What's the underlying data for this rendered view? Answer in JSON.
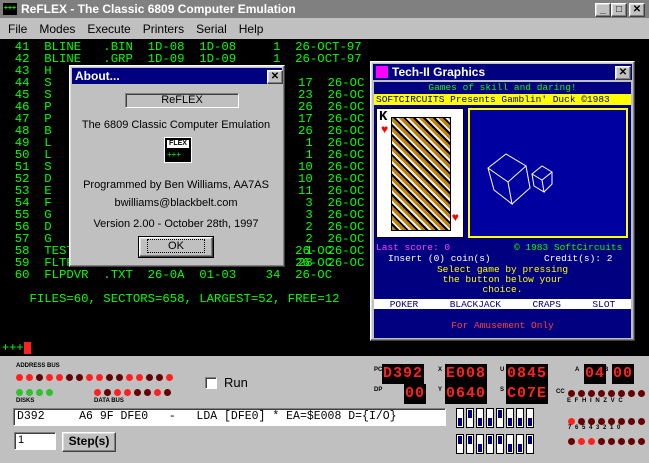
{
  "main_window": {
    "title": "ReFLEX - The Classic 6809 Computer Emulation"
  },
  "menu": [
    "File",
    "Modes",
    "Execute",
    "Printers",
    "Serial",
    "Help"
  ],
  "terminal": {
    "lines": [
      "  41  BLINE   .BIN  1D-08  1D-08     1  26-OCT-97",
      "  42  BLINE   .GRP  1D-09  1D-09     1  26-OCT-97",
      "  43  H",
      "  44  S",
      "  45  S",
      "  46  P",
      "  47  P",
      "  48  B",
      "  49  L",
      "  50  L",
      "  51  S",
      "  52  D",
      "  53  E",
      "  54  F",
      "  55  G",
      "  56  D",
      "  57  G",
      "  58  TEST    .CAL  25-03  25-03     1  26-OC",
      "  59  FLTPT   .TXT  25-04  26-09    26  26-OC",
      "  60  FLPDVR  .TXT  26-0A  01-03    34  26-OC",
      "",
      "    FILES=60, SECTORS=658, LARGEST=52, FREE=12"
    ],
    "right_cols": [
      "17  26-OC",
      "23  26-OC",
      "26  26-OC",
      "17  26-OC",
      "26  26-OC",
      "1  26-OC",
      "1  26-OC",
      "10  26-OC",
      "10  26-OC",
      "11  26-OC",
      "3  26-OC",
      "3  26-OC",
      "2  26-OC",
      "2  26-OC",
      "1  26-OC",
      "28  26-OC"
    ],
    "prompt": "+++"
  },
  "about": {
    "title": "About...",
    "name": "ReFLEX",
    "subtitle": "The 6809 Classic Computer Emulation",
    "icon_text": "FLEX",
    "icon_prompt": "+++",
    "author": "Programmed by Ben Williams, AA7AS",
    "email": "bwilliams@blackbelt.com",
    "version": "Version 2.00 - October 28th, 1997",
    "ok": "OK"
  },
  "graphics": {
    "title": "Tech-II Graphics",
    "tagline": "Games of skill and daring!",
    "presents": "SOFTCIRCUITS Presents Gamblin' Duck ©1983",
    "last_score": "Last score: 0",
    "copyright": "© 1983 SoftCircuits",
    "insert": "Insert (0) coin(s)",
    "credits": "Credit(s): 2",
    "select1": "Select game by pressing",
    "select2": "the button below your",
    "select3": "choice.",
    "games": [
      "POKER",
      "BLACKJACK",
      "CRAPS",
      "SLOT"
    ],
    "footer": "For  Amusement  Only",
    "card": "K"
  },
  "panel": {
    "address_bus": "ADDRESS BUS",
    "disks": "DISKS",
    "data_bus": "DATA BUS",
    "run": "Run",
    "disasm": "D392     A6 9F DFE0   -   LDA [DFE0] * EA=$E008 D={I/O}",
    "step_count": "1",
    "step": "Step(s)",
    "regs": {
      "pc": "D392",
      "dp": "00",
      "x": "E008",
      "y": "0640",
      "u": "0845",
      "s": "C07E",
      "a": "04",
      "b": "00",
      "cc": "00"
    },
    "reg_labels": {
      "pc": "PC",
      "dp": "DP",
      "x": "X",
      "y": "Y",
      "u": "U",
      "s": "S",
      "a": "A",
      "b": "B",
      "cc": "CC"
    },
    "cc_flags": "E F H I N Z V C",
    "bits": "7 6 5 4 3 2 1 0"
  },
  "colors": {
    "title_bar": "#000080",
    "terminal_bg": "#000000",
    "terminal_fg": "#00ff00",
    "graphics_bg": "#000080",
    "led_on": "#ff2020"
  }
}
